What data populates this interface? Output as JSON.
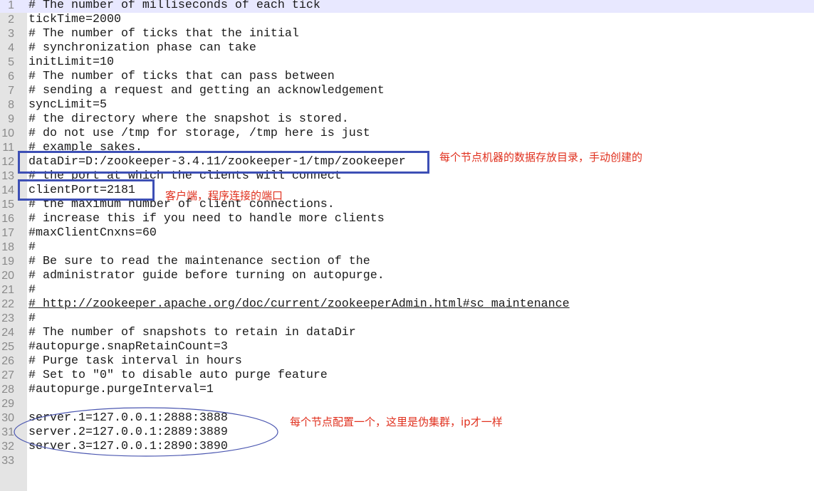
{
  "editor": {
    "current_line": 1,
    "lines": [
      "# The number of milliseconds of each tick",
      "tickTime=2000",
      "# The number of ticks that the initial",
      "# synchronization phase can take",
      "initLimit=10",
      "# The number of ticks that can pass between",
      "# sending a request and getting an acknowledgement",
      "syncLimit=5",
      "# the directory where the snapshot is stored.",
      "# do not use /tmp for storage, /tmp here is just",
      "# example sakes.",
      "dataDir=D:/zookeeper-3.4.11/zookeeper-1/tmp/zookeeper",
      "# the port at which the clients will connect",
      "clientPort=2181",
      "# the maximum number of client connections.",
      "# increase this if you need to handle more clients",
      "#maxClientCnxns=60",
      "#",
      "# Be sure to read the maintenance section of the",
      "# administrator guide before turning on autopurge.",
      "#",
      "# http://zookeeper.apache.org/doc/current/zookeeperAdmin.html#sc_maintenance",
      "#",
      "# The number of snapshots to retain in dataDir",
      "#autopurge.snapRetainCount=3",
      "# Purge task interval in hours",
      "# Set to \"0\" to disable auto purge feature",
      "#autopurge.purgeInterval=1",
      "",
      "server.1=127.0.0.1:2888:3888",
      "server.2=127.0.0.1:2889:3889",
      "server.3=127.0.0.1:2890:3890",
      ""
    ],
    "link_line": 22
  },
  "annotations": {
    "datadir_note": "每个节点机器的数据存放目录，手动创建的",
    "clientport_note": "客户端，程序连接的端口",
    "servers_note": "每个节点配置一个，这里是伪集群，ip才一样"
  },
  "colors": {
    "annotation_text": "#e0301e",
    "box": "#3d4fb5",
    "ellipse": "#4a56b0",
    "current_line": "#e8e8ff"
  }
}
